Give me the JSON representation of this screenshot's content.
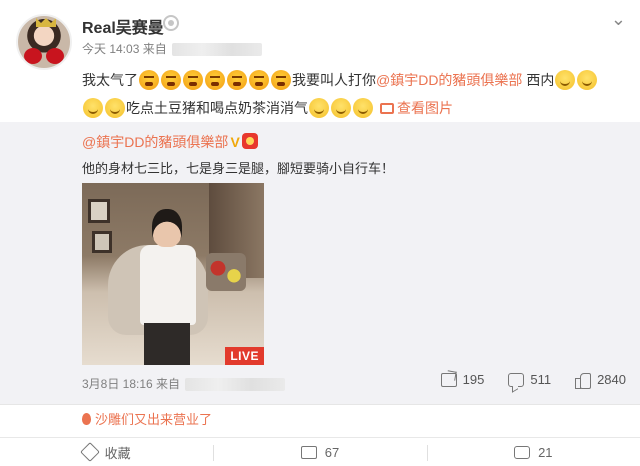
{
  "post": {
    "username": "Real吴赛曼",
    "time": "今天 14:03 来自",
    "line1_text": "我太气了",
    "line1_after": "我要叫人打你",
    "mention": "@鎮宇DD的豬頭俱樂部",
    "line1_end": "西内",
    "line2_text": "吃点土豆猪和喝点奶茶消消气",
    "view_image": "查看图片",
    "icons": {
      "vip": "vip-badge-icon",
      "menu": "chevron-down-icon",
      "emoji_angry": "angry-face-icon",
      "emoji_smile": "smile-face-icon"
    }
  },
  "repost": {
    "author": "@鎮宇DD的豬頭俱樂部",
    "verified": "V",
    "text": "他的身材七三比，七是身三是腿，腳短要骑小自行车！",
    "live_label": "LIVE",
    "time": "3月8日 18:16 来自",
    "shares": "195",
    "comments": "511",
    "likes": "2840"
  },
  "source_link": "沙雕们又出来营业了",
  "footer": {
    "collect": "收藏",
    "shares": "67",
    "comments": "21"
  },
  "colors": {
    "accent": "#eb7350",
    "repost_bg": "#f2f2f5",
    "live_red": "#e23a2c"
  }
}
